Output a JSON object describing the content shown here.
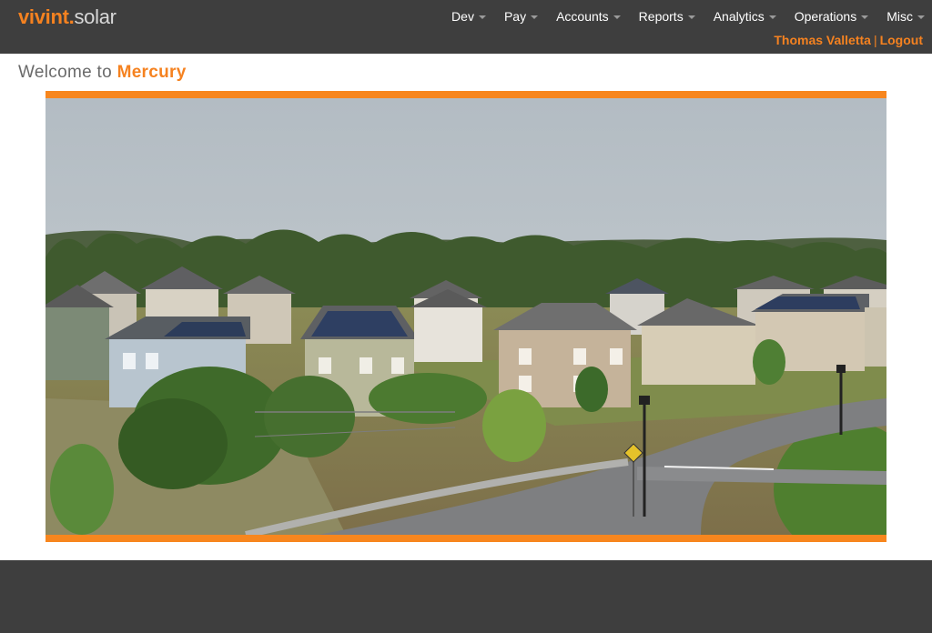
{
  "header": {
    "logo": {
      "brand": "vivint",
      "dot": ".",
      "product": "solar"
    },
    "nav": [
      {
        "label": "Dev"
      },
      {
        "label": "Pay"
      },
      {
        "label": "Accounts"
      },
      {
        "label": "Reports"
      },
      {
        "label": "Analytics"
      },
      {
        "label": "Operations"
      },
      {
        "label": "Misc"
      }
    ],
    "user": {
      "name": "Thomas Valletta",
      "separator": "|",
      "logout": "Logout"
    }
  },
  "main": {
    "welcome_prefix": "Welcome to",
    "app_name": "Mercury",
    "hero_image": "suburban-solar-neighborhood-photo"
  },
  "colors": {
    "accent": "#f58220",
    "header_bg": "#3e3e3e",
    "footer_bg": "#3e3e3e",
    "hero_border": "#f7861e"
  }
}
